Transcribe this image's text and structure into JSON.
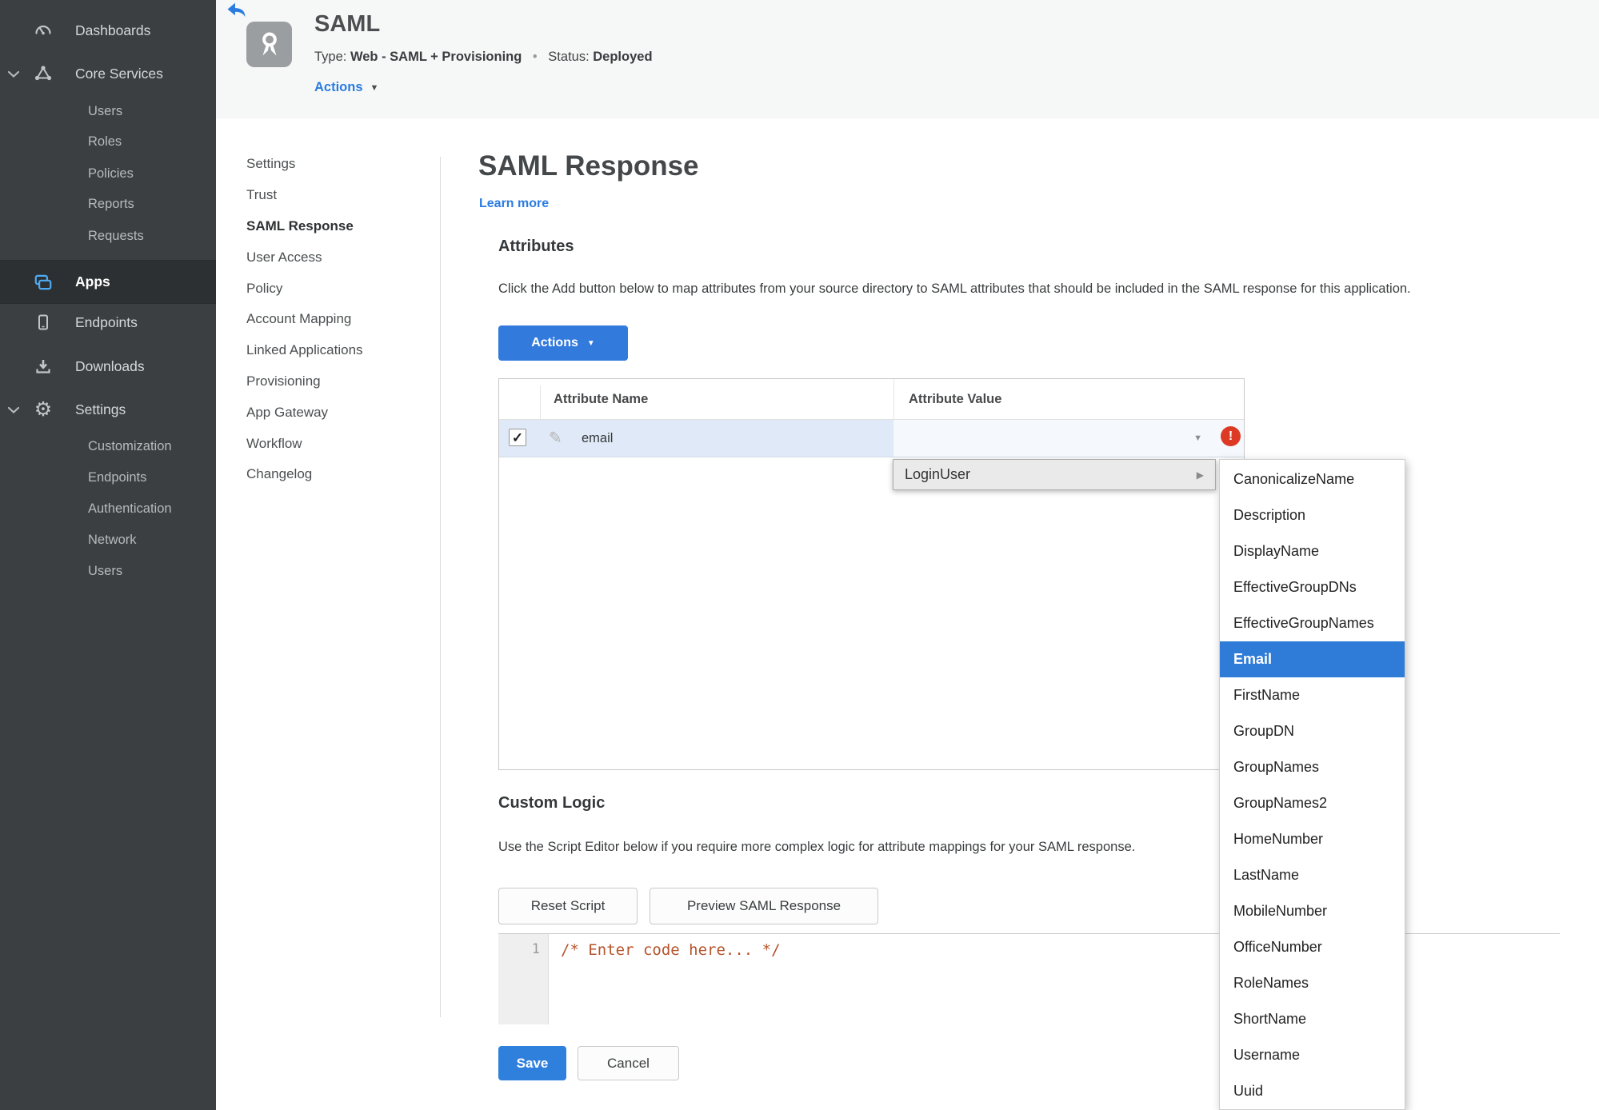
{
  "colors": {
    "accent_blue": "#2f7cda",
    "selection_blue": "#2e7cd8",
    "status_green": "#3f8b34",
    "error_red": "#dd3a26",
    "sidebar_bg": "#3b3f42"
  },
  "icons": {
    "caret_down": "▼",
    "submenu_arrow": "▶",
    "pencil": "✎",
    "check": "✓",
    "error_mark": "!",
    "bullet": "•",
    "gear": "⚙"
  },
  "sidebar": {
    "dashboards": "Dashboards",
    "core_services": "Core Services",
    "core_children": [
      "Users",
      "Roles",
      "Policies",
      "Reports",
      "Requests"
    ],
    "apps": "Apps",
    "endpoints": "Endpoints",
    "downloads": "Downloads",
    "settings": "Settings",
    "settings_children": [
      "Customization",
      "Endpoints",
      "Authentication",
      "Network",
      "Users"
    ]
  },
  "header": {
    "title": "SAML",
    "type_label": "Type:",
    "type_value": "Web - SAML + Provisioning",
    "status_label": "Status:",
    "status_value": "Deployed",
    "actions_label": "Actions"
  },
  "subnav": {
    "items": [
      "Settings",
      "Trust",
      "SAML Response",
      "User Access",
      "Policy",
      "Account Mapping",
      "Linked Applications",
      "Provisioning",
      "App Gateway",
      "Workflow",
      "Changelog"
    ],
    "active": "SAML Response"
  },
  "main": {
    "title": "SAML Response",
    "learn_more": "Learn more",
    "attributes": {
      "heading": "Attributes",
      "description": "Click the Add button below to map attributes from your source directory to SAML attributes that should be included in the SAML response for this application.",
      "actions_button": "Actions",
      "columns": {
        "name": "Attribute Name",
        "value": "Attribute Value"
      },
      "row": {
        "name": "email",
        "value": ""
      }
    },
    "value_menu": {
      "parent": "LoginUser",
      "submenu": [
        "CanonicalizeName",
        "Description",
        "DisplayName",
        "EffectiveGroupDNs",
        "EffectiveGroupNames",
        "Email",
        "FirstName",
        "GroupDN",
        "GroupNames",
        "GroupNames2",
        "HomeNumber",
        "LastName",
        "MobileNumber",
        "OfficeNumber",
        "RoleNames",
        "ShortName",
        "Username",
        "Uuid"
      ],
      "selected": "Email"
    },
    "custom_logic": {
      "heading": "Custom Logic",
      "description": "Use the Script Editor below if you require more complex logic for attribute mappings for your SAML response.",
      "reset_button": "Reset Script",
      "preview_button": "Preview SAML Response",
      "editor": {
        "line_number": "1",
        "code": "/* Enter code here... */"
      }
    },
    "footer": {
      "save": "Save",
      "cancel": "Cancel"
    }
  }
}
